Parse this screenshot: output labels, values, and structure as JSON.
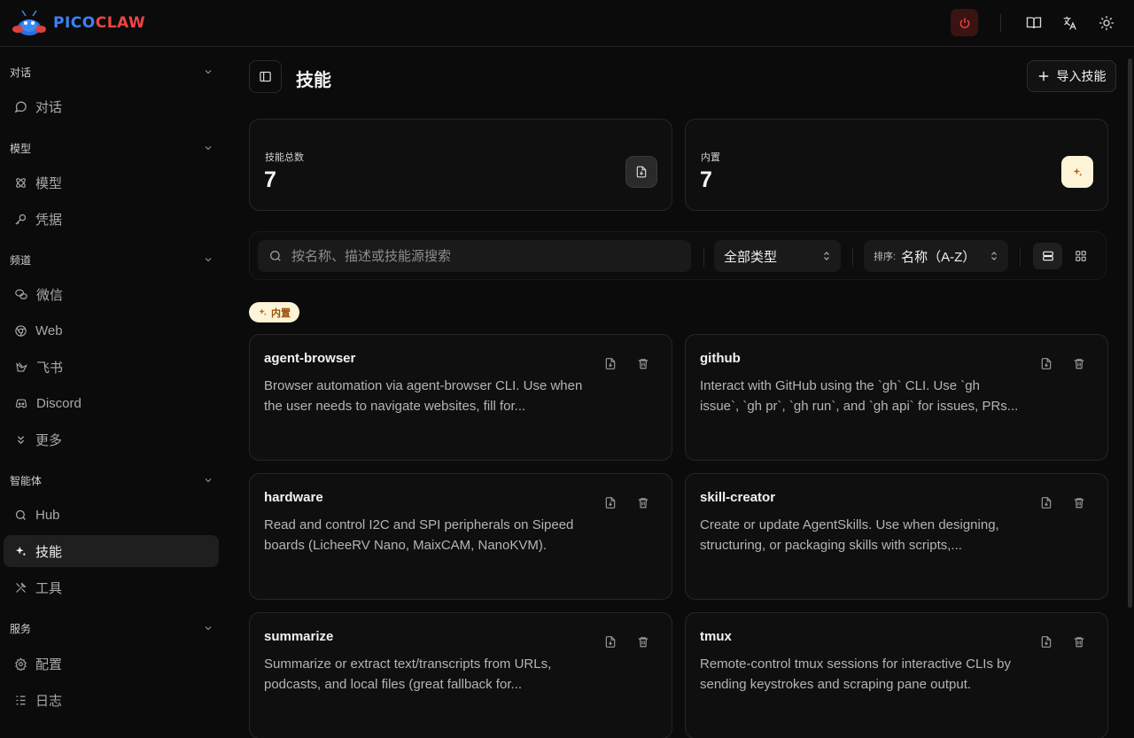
{
  "brand": {
    "name_part1": "PICO",
    "name_part2": "CLAW"
  },
  "sidebar": {
    "sections": [
      {
        "title": "对话",
        "items": [
          {
            "label": "对话",
            "icon": "message-circle-icon"
          }
        ]
      },
      {
        "title": "模型",
        "items": [
          {
            "label": "模型",
            "icon": "atom-icon"
          },
          {
            "label": "凭据",
            "icon": "key-icon"
          }
        ]
      },
      {
        "title": "频道",
        "items": [
          {
            "label": "微信",
            "icon": "wechat-icon"
          },
          {
            "label": "Web",
            "icon": "chrome-icon"
          },
          {
            "label": "飞书",
            "icon": "feishu-icon"
          },
          {
            "label": "Discord",
            "icon": "discord-icon"
          },
          {
            "label": "更多",
            "icon": "chevrons-down-icon"
          }
        ]
      },
      {
        "title": "智能体",
        "items": [
          {
            "label": "Hub",
            "icon": "search-icon"
          },
          {
            "label": "技能",
            "icon": "sparkles-icon"
          },
          {
            "label": "工具",
            "icon": "tools-icon"
          }
        ]
      },
      {
        "title": "服务",
        "items": [
          {
            "label": "配置",
            "icon": "gear-icon"
          },
          {
            "label": "日志",
            "icon": "list-icon"
          }
        ]
      }
    ],
    "active_item": "技能"
  },
  "header": {
    "title": "技能",
    "import_label": "导入技能"
  },
  "stats": [
    {
      "label": "技能总数",
      "value": "7",
      "icon": "file-icon"
    },
    {
      "label": "内置",
      "value": "7",
      "icon": "sparkles-icon"
    }
  ],
  "toolbar": {
    "search_placeholder": "按名称、描述或技能源搜索",
    "type_filter": "全部类型",
    "sort_prefix": "排序:",
    "sort_value": "名称（A-Z）"
  },
  "group_badge": "内置",
  "skills": [
    {
      "name": "agent-browser",
      "description": "Browser automation via agent-browser CLI. Use when the user needs to navigate websites, fill for..."
    },
    {
      "name": "github",
      "description": "Interact with GitHub using the `gh` CLI. Use `gh issue`, `gh pr`, `gh run`, and `gh api` for issues, PRs..."
    },
    {
      "name": "hardware",
      "description": "Read and control I2C and SPI peripherals on Sipeed boards (LicheeRV Nano, MaixCAM, NanoKVM)."
    },
    {
      "name": "skill-creator",
      "description": "Create or update AgentSkills. Use when designing, structuring, or packaging skills with scripts,..."
    },
    {
      "name": "summarize",
      "description": "Summarize or extract text/transcripts from URLs, podcasts, and local files (great fallback for..."
    },
    {
      "name": "tmux",
      "description": "Remote-control tmux sessions for interactive CLIs by sending keystrokes and scraping pane output."
    }
  ],
  "colors": {
    "power_danger": "#ef4444",
    "badge_bg": "#fdf3d6",
    "badge_fg": "#9a4e0d",
    "active_nav_bg": "#1f1f1f"
  }
}
